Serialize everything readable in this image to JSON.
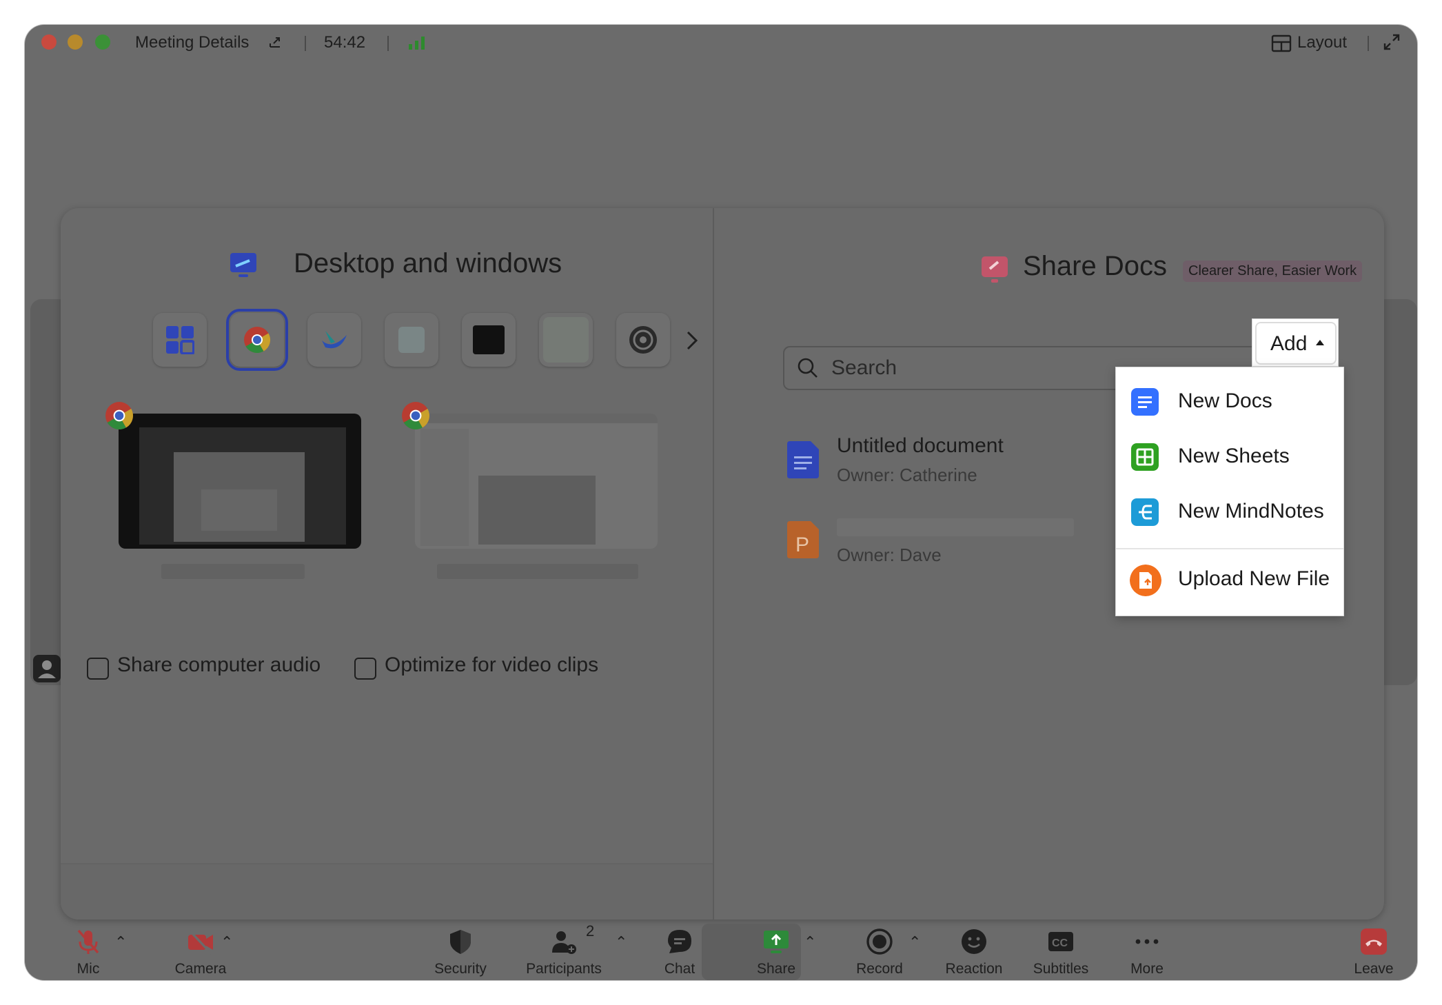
{
  "titlebar": {
    "meeting_details": "Meeting Details",
    "timer": "54:42",
    "layout_label": "Layout"
  },
  "desktop_panel": {
    "title": "Desktop and windows",
    "share_audio_label": "Share computer audio",
    "optimize_label": "Optimize for video clips"
  },
  "docs_panel": {
    "title": "Share Docs",
    "tag": "Clearer Share, Easier Work",
    "search_placeholder": "Search",
    "add_label": "Add",
    "docs": [
      {
        "title": "Untitled document",
        "owner": "Owner: Catherine"
      },
      {
        "title": "",
        "owner": "Owner: Dave"
      }
    ]
  },
  "add_menu": {
    "items": [
      {
        "label": "New Docs",
        "color": "#3370ff"
      },
      {
        "label": "New Sheets",
        "color": "#2ea121"
      },
      {
        "label": "New MindNotes",
        "color": "#1d9bd7"
      },
      {
        "label": "Upload New File",
        "color": "#f26f1c"
      }
    ]
  },
  "toolbar": {
    "mic": "Mic",
    "camera": "Camera",
    "security": "Security",
    "participants": "Participants",
    "participants_count": "2",
    "chat": "Chat",
    "share": "Share",
    "record": "Record",
    "reaction": "Reaction",
    "subtitles": "Subtitles",
    "more": "More",
    "leave": "Leave"
  }
}
